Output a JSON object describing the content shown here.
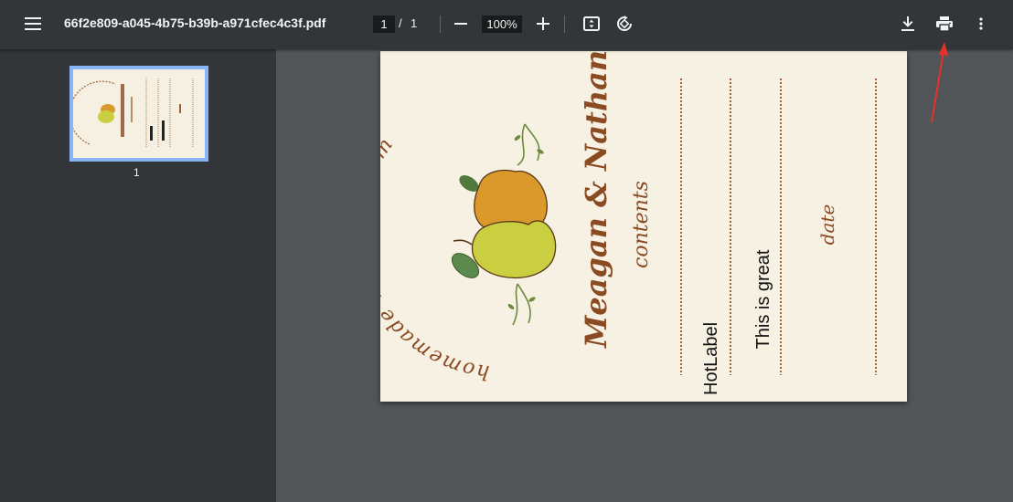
{
  "toolbar": {
    "filename": "66f2e809-a045-4b75-b39b-a971cfec4c3f.pdf",
    "page_current": "1",
    "page_separator": "/",
    "page_total": "1",
    "zoom": "100%",
    "icons": [
      "menu-icon",
      "zoom-out-icon",
      "zoom-in-icon",
      "fit-page-icon",
      "rotate-icon",
      "download-icon",
      "print-icon",
      "more-vert-icon"
    ]
  },
  "sidebar": {
    "thumbnails": [
      {
        "page_number": "1",
        "selected": true
      }
    ]
  },
  "document": {
    "background_color": "#f6f1e2",
    "arc_text": "homemade with love from",
    "names": "Meagan & Nathan",
    "contents_label": "contents",
    "date_label": "date",
    "fields": [
      "HotLabel",
      "This is great"
    ],
    "accent_color": "#8a4a22"
  },
  "annotation": {
    "arrow_color": "#e8302a",
    "target": "print-icon"
  }
}
